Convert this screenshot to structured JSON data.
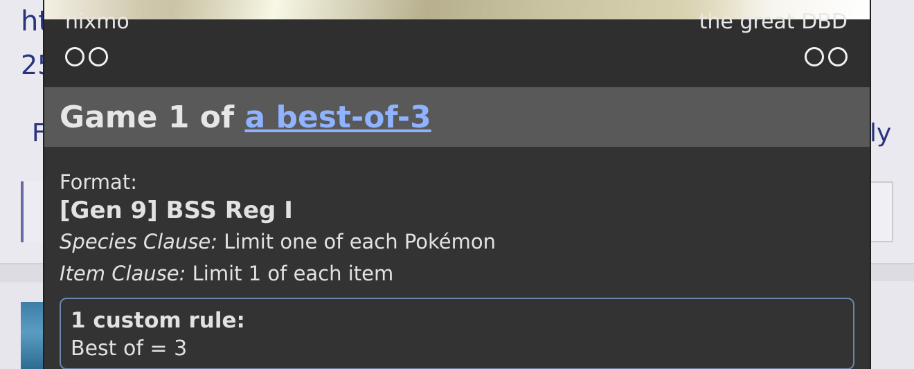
{
  "background": {
    "link_fragment": "ht",
    "number_fragment": "25",
    "left_fragment": "F",
    "right_fragment": "ly"
  },
  "popup": {
    "players": {
      "left_name": "nixmo",
      "right_name": "the great DBD"
    },
    "game": {
      "prefix": "Game 1 of ",
      "link_text": "a best-of-3"
    },
    "format": {
      "label": "Format:",
      "name": "[Gen 9] BSS Reg I",
      "clauses": [
        {
          "name": "Species Clause:",
          "text": " Limit one of each Pokémon"
        },
        {
          "name": "Item Clause:",
          "text": " Limit 1 of each item"
        }
      ]
    },
    "custom_rules": {
      "title": "1 custom rule:",
      "rules": [
        "Best of = 3"
      ]
    },
    "colors": {
      "link": "#8fb3ff",
      "panel_bg": "#333333",
      "header_bg": "#595959",
      "rule_border": "#6f86ad"
    }
  }
}
